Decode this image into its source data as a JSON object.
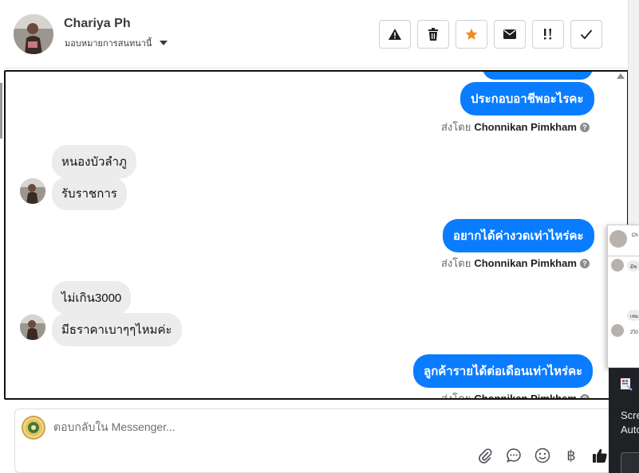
{
  "header": {
    "contact_name": "Chariya Ph",
    "assign_label": "มอบหมายการสนทนานี้"
  },
  "actions": [
    {
      "name": "report-button",
      "icon": "warning-icon"
    },
    {
      "name": "delete-button",
      "icon": "trash-icon"
    },
    {
      "name": "star-button",
      "icon": "star-icon"
    },
    {
      "name": "mark-unread-button",
      "icon": "envelope-icon"
    },
    {
      "name": "priority-button",
      "icon": "exclamation-icon"
    },
    {
      "name": "mark-done-button",
      "icon": "check-icon"
    }
  ],
  "colors": {
    "accent_blue": "#0a7cff",
    "star_orange": "#f08a24",
    "incoming_bubble": "#ececec"
  },
  "messages": {
    "out_1": "ประกอบอาชีพอะไรคะ",
    "in_1": "หนองบัวลำภู",
    "in_2": "รับราชการ",
    "out_2": "อยากได้ค่างวดเท่าไหร่คะ",
    "in_3": "ไม่เกิน3000",
    "in_4": "มีธราคาเบาๆๆไหมค่ะ",
    "out_3": "ลูกค้ารายได้ต่อเดือนเท่าไหร่คะ"
  },
  "sent_by": {
    "prefix": "ส่งโดย",
    "agent": "Chonnikan Pimkham",
    "help": "?"
  },
  "composer": {
    "placeholder": "ตอบกลับใน Messenger...",
    "currency_symbol": "฿"
  },
  "popup": {
    "name_short": "Ch",
    "bubble_1": "มีช",
    "bubble_2": "เหม",
    "bubble_3": "2ไ0"
  },
  "dark_panel": {
    "line_1": "Scre",
    "line_2": "Auto"
  }
}
